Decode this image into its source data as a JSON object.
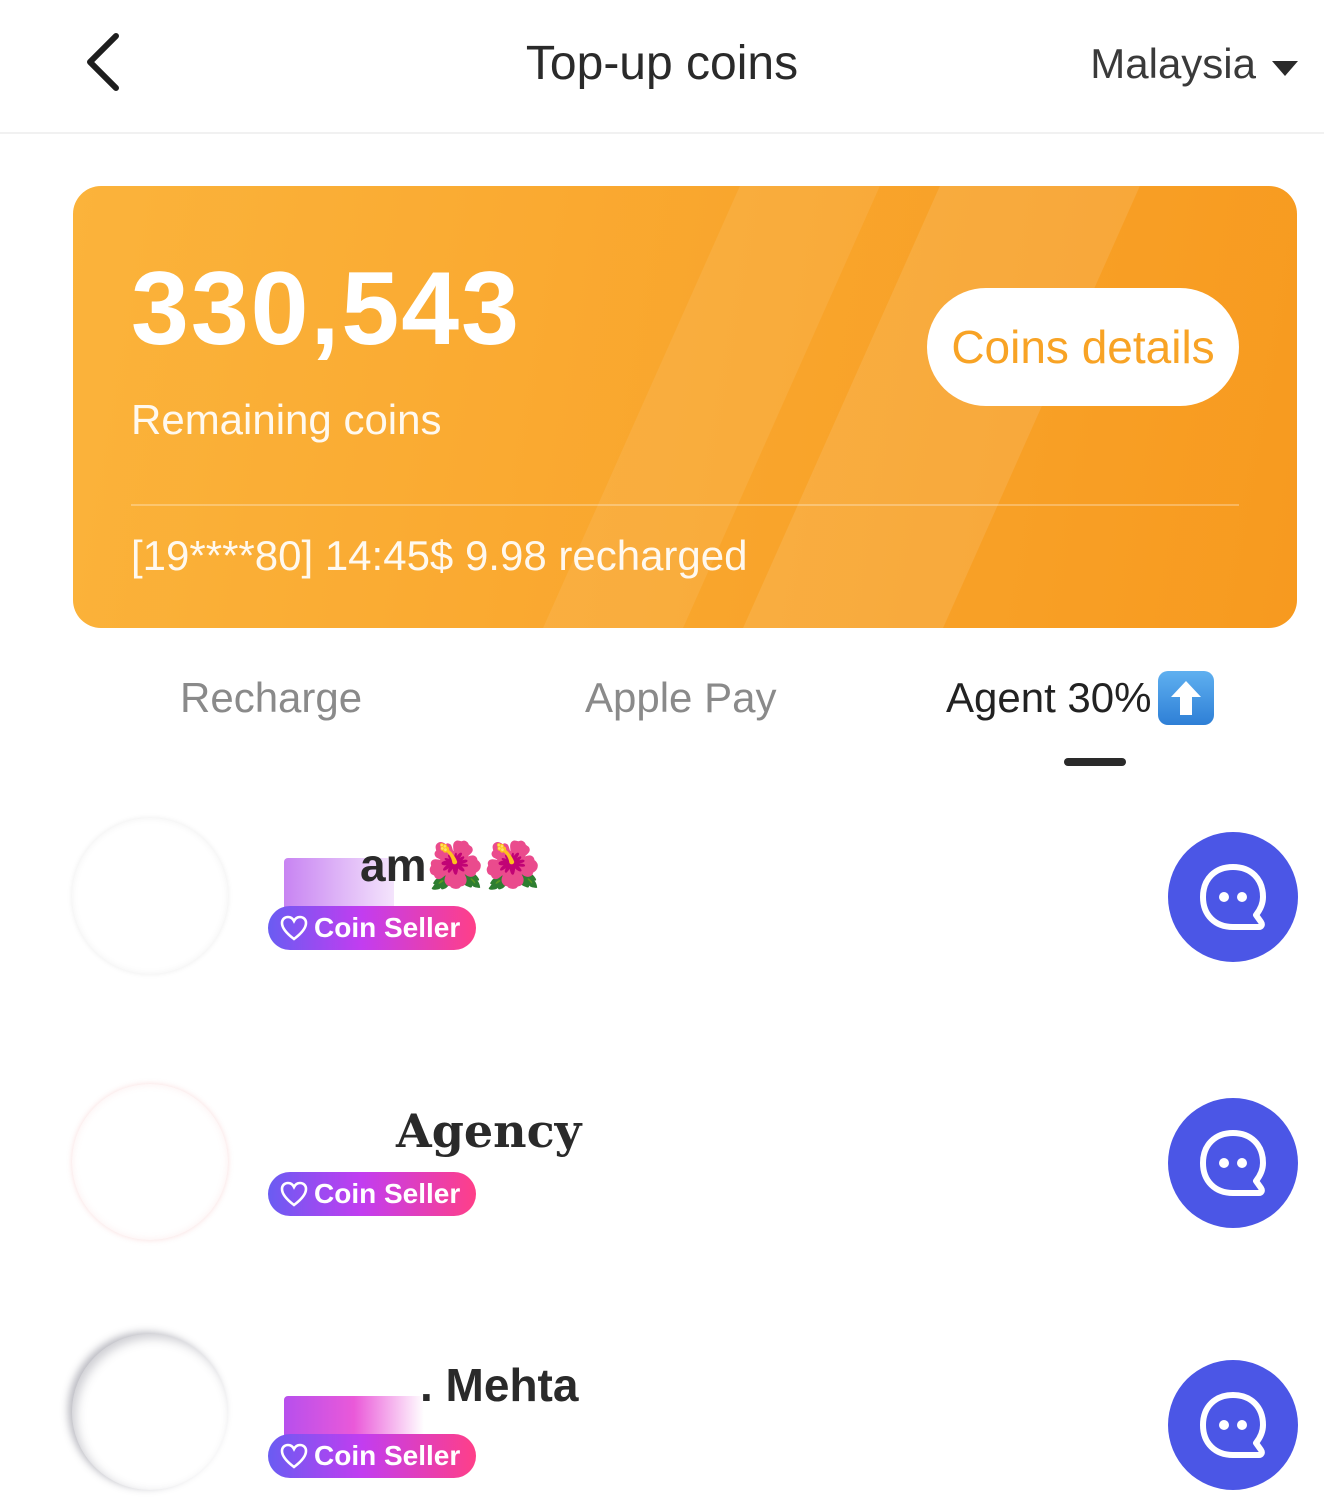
{
  "header": {
    "title": "Top-up coins",
    "region": "Malaysia"
  },
  "card": {
    "balance": "330,543",
    "balance_label": "Remaining coins",
    "details_button": "Coins details",
    "ticker": "[19****80] 14:45$ 9.98 recharged"
  },
  "tabs": [
    {
      "label": "Recharge",
      "active": false
    },
    {
      "label": "Apple Pay",
      "active": false
    },
    {
      "label": "Agent 30%",
      "active": true,
      "icon": "up-arrow-icon"
    }
  ],
  "sellers": [
    {
      "name": "am🌺🌺",
      "badge": "Coin Seller",
      "action_icon": "chat-icon"
    },
    {
      "name": "Agency",
      "badge": "Coin Seller",
      "action_icon": "chat-icon"
    },
    {
      "name": ". Mehta",
      "badge": "Coin Seller",
      "action_icon": "chat-icon"
    }
  ],
  "colors": {
    "card_orange": "#f9a52c",
    "accent_blue": "#4b56e6",
    "badge_gradient": [
      "#6a5cf2",
      "#c23df0",
      "#ff3f88"
    ]
  }
}
